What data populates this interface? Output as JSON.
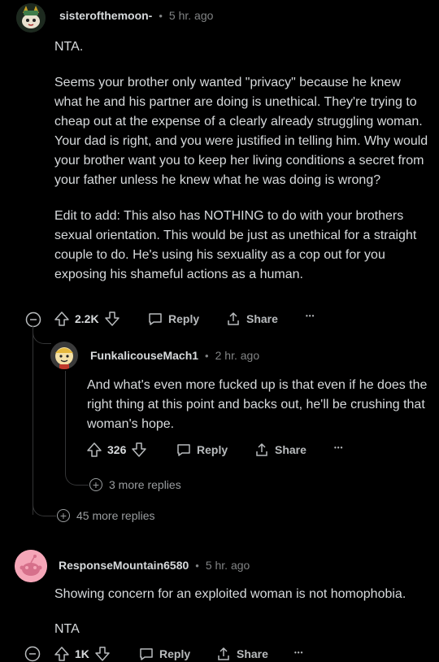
{
  "comment1": {
    "username": "sisterofthemoon-",
    "separator": "•",
    "time": "5 hr. ago",
    "paragraphs": [
      "NTA.",
      "Seems your brother only wanted \"privacy\" because he knew what he and his partner are doing is unethical. They're trying to cheap out at the expense of a clearly already struggling woman. Your dad is right, and you were justified in telling him. Why would your brother want you to keep her living conditions a secret from your father unless he knew what he was doing is wrong?",
      "Edit to add: This also has NOTHING to do with your brothers sexual orientation. This would be just as unethical for a straight couple to do. He's using his sexuality as a cop out for you exposing his shameful actions as a human."
    ],
    "votes": "2.2K",
    "reply_label": "Reply",
    "share_label": "Share",
    "more_label": "•••",
    "collapse_icon": "minus-circle-icon",
    "more_replies": "45 more replies"
  },
  "comment2": {
    "username": "FunkalicouseMach1",
    "separator": "•",
    "time": "2 hr. ago",
    "paragraphs": [
      "And what's even more fucked up is that even if he does the right thing at this point and backs out, he'll be crushing that woman's hope."
    ],
    "votes": "326",
    "reply_label": "Reply",
    "share_label": "Share",
    "more_label": "•••",
    "more_replies": "3 more replies"
  },
  "comment3": {
    "username": "ResponseMountain6580",
    "separator": "•",
    "time": "5 hr. ago",
    "paragraphs": [
      "Showing concern for an exploited woman is not homophobia.",
      "NTA"
    ],
    "votes": "1K",
    "reply_label": "Reply",
    "share_label": "Share",
    "more_label": "•••"
  },
  "colors": {
    "background": "#000000",
    "text": "#d7dadc",
    "muted": "#818384",
    "avatar3": "#f5a6b8"
  }
}
